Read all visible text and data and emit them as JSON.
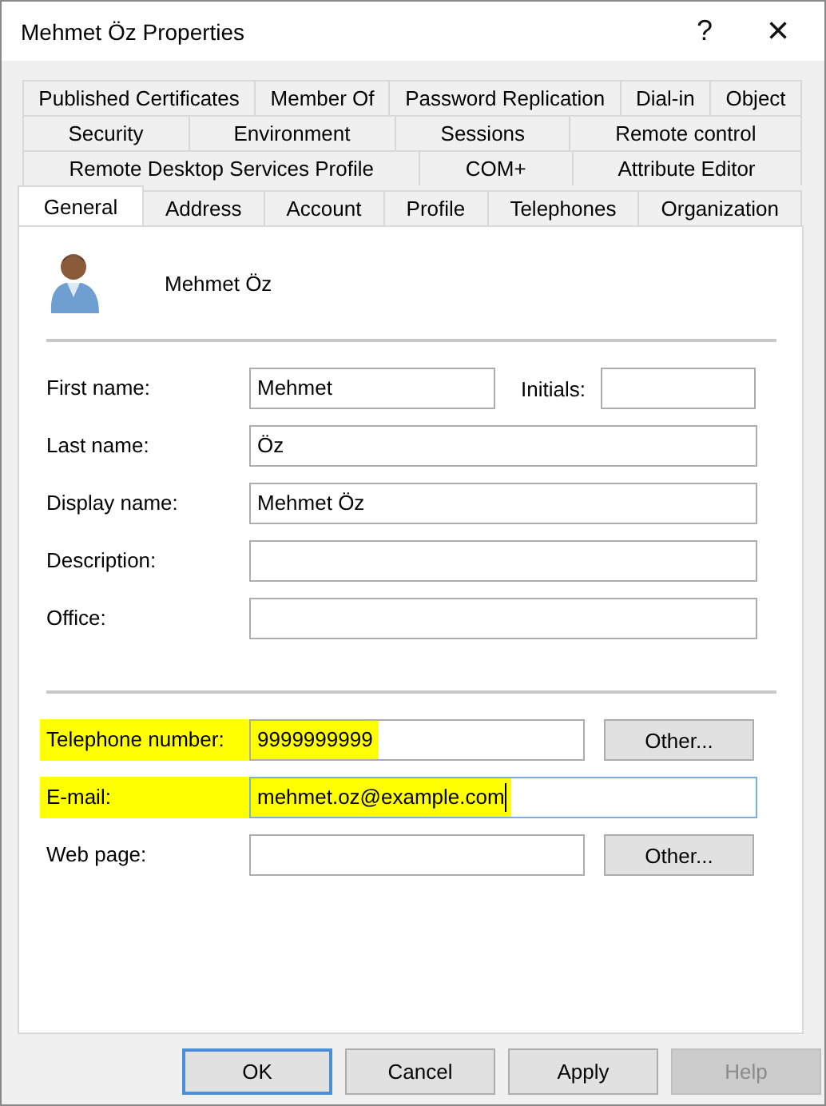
{
  "window": {
    "title": "Mehmet Öz Properties",
    "controls": [
      {
        "kind": "help",
        "label": "?"
      },
      {
        "kind": "close",
        "label": "×"
      }
    ]
  },
  "tab_rows": [
    [
      {
        "label": "Published Certificates",
        "selected": false
      },
      {
        "label": "Member Of",
        "selected": false
      },
      {
        "label": "Password Replication",
        "selected": false
      },
      {
        "label": "Dial-in",
        "selected": false
      },
      {
        "label": "Object",
        "selected": false
      }
    ],
    [
      {
        "label": "Security",
        "selected": false
      },
      {
        "label": "Environment",
        "selected": false
      },
      {
        "label": "Sessions",
        "selected": false
      },
      {
        "label": "Remote control",
        "selected": false
      }
    ],
    [
      {
        "label": "Remote Desktop Services Profile",
        "selected": false
      },
      {
        "label": "COM+",
        "selected": false
      },
      {
        "label": "Attribute Editor",
        "selected": false
      }
    ],
    [
      {
        "label": "General",
        "selected": true
      },
      {
        "label": "Address",
        "selected": false
      },
      {
        "label": "Account",
        "selected": false
      },
      {
        "label": "Profile",
        "selected": false
      },
      {
        "label": "Telephones",
        "selected": false
      },
      {
        "label": "Organization",
        "selected": false
      }
    ]
  ],
  "header": {
    "name": "Mehmet Öz"
  },
  "name_fields": [
    {
      "label": "First name:",
      "value": "Mehmet",
      "highlighted": false,
      "focused": false,
      "side": {
        "label": "Initials:"
      }
    },
    {
      "label": "Last name:",
      "value": "Öz",
      "highlighted": false,
      "focused": false
    },
    {
      "label": "Display name:",
      "value": "Mehmet Öz",
      "highlighted": false,
      "focused": false
    },
    {
      "label": "Description:",
      "highlighted": false,
      "focused": false
    },
    {
      "label": "Office:",
      "highlighted": false,
      "focused": false
    }
  ],
  "contact_fields": [
    {
      "label": "Telephone number:",
      "value": "9999999999",
      "highlighted": true,
      "focused": false,
      "button": "Other..."
    },
    {
      "label": "E-mail:",
      "value": "mehmet.oz@example.com",
      "highlighted": true,
      "focused": true
    },
    {
      "label": "Web page:",
      "highlighted": false,
      "focused": false,
      "button": "Other..."
    }
  ],
  "buttons": [
    {
      "label": "OK",
      "default": true,
      "disabled": false
    },
    {
      "label": "Cancel",
      "default": false,
      "disabled": false
    },
    {
      "label": "Apply",
      "default": false,
      "disabled": false
    },
    {
      "label": "Help",
      "default": false,
      "disabled": true
    }
  ]
}
